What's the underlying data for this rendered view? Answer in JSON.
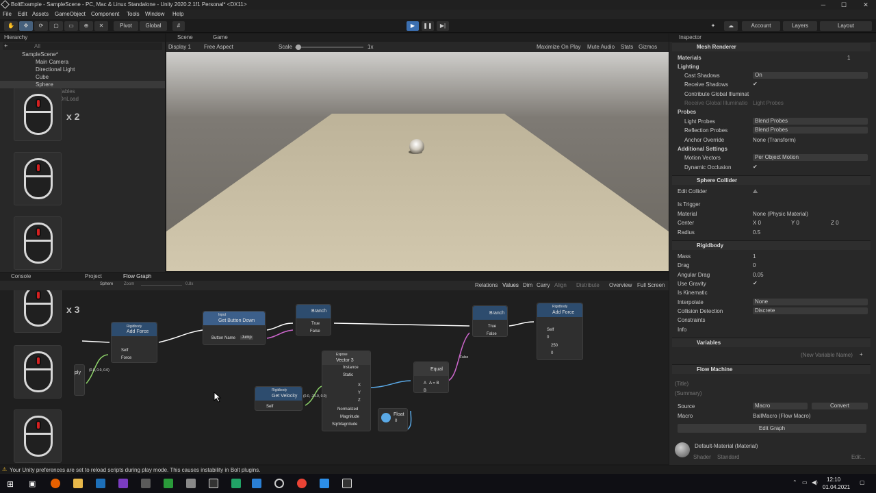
{
  "window": {
    "title": "BoltExample - SampleScene - PC, Mac & Linux Standalone - Unity 2020.2.1f1 Personal* <DX11>",
    "min": "─",
    "max": "☐",
    "close": "✕"
  },
  "menu": [
    "File",
    "Edit",
    "Assets",
    "GameObject",
    "Component",
    "Tools",
    "Window",
    "Help"
  ],
  "toolbar": {
    "pivot": "Pivot",
    "global": "Global",
    "account": "Account",
    "layers": "Layers",
    "layout": "Layout"
  },
  "hierarchy": {
    "tab": "Hierarchy",
    "search_placeholder": "All",
    "scene": "SampleScene*",
    "items": [
      "Main Camera",
      "Directional Light",
      "Cube",
      "Sphere",
      "Scene Variables"
    ],
    "ddol": "DontDestroyOnLoad",
    "mouse_counts": [
      "x 2",
      "x 3"
    ]
  },
  "sceneview": {
    "tabs": [
      "Scene",
      "Game"
    ],
    "display": "Display 1",
    "aspect": "Free Aspect",
    "scale_label": "Scale",
    "scale_value": "1x",
    "options": [
      "Maximize On Play",
      "Mute Audio",
      "Stats",
      "Gizmos"
    ]
  },
  "bottom": {
    "tabs": [
      "Console",
      "Project",
      "Flow Graph"
    ],
    "breadcrumb": "Sphere",
    "zoom_label": "Zoom",
    "zoom_value": "0.8x",
    "options": [
      "Relations",
      "Values",
      "Dim",
      "Carry",
      "Align",
      "Distribute",
      "Overview",
      "Full Screen"
    ],
    "console_msg": "Your Unity preferences are set to reload scripts during play mode. This causes instability in Bolt plugins."
  },
  "graph": {
    "add_force_1": {
      "cat": "Rigidbody",
      "title": "Add Force",
      "ports": [
        "Self",
        "Force"
      ]
    },
    "get_button_down": {
      "cat": "Input",
      "title": "Get Button Down",
      "port": "Button Name",
      "value": "Jump"
    },
    "branch_1": {
      "title": "Branch",
      "true": "True",
      "false": "False"
    },
    "branch_2": {
      "title": "Branch",
      "true": "True",
      "false": "False"
    },
    "add_force_2": {
      "cat": "Rigidbody",
      "title": "Add Force",
      "self": "Self",
      "x": "0",
      "y": "250",
      "z": "0"
    },
    "expose": {
      "cat": "Expose",
      "title": "Vector 3",
      "ports": [
        "Instance",
        "Static"
      ],
      "outs": [
        "X",
        "Y",
        "Z",
        "Normalized",
        "Magnitude",
        "SqrMagnitude"
      ]
    },
    "get_velocity": {
      "cat": "Rigidbody",
      "title": "Get Velocity",
      "self": "Self",
      "vec": "(0.0, -21.0, 0.0)"
    },
    "equal": {
      "title": "Equal",
      "a": "A",
      "ab": "A = B",
      "b": "B"
    },
    "float": {
      "title": "Float",
      "value": "0"
    },
    "vec_left": "(0.0, 0.0, 0.0)",
    "false_label": "False",
    "pd": "ply"
  },
  "inspector": {
    "tab": "Inspector",
    "mesh_renderer": "Mesh Renderer",
    "materials": "Materials",
    "materials_count": "1",
    "lighting": "Lighting",
    "cast_shadows": "Cast Shadows",
    "cast_shadows_val": "On",
    "receive_shadows": "Receive Shadows",
    "contribute_gi": "Contribute Global Illuminat",
    "receive_gi": "Receive Global Illuminatio",
    "receive_gi_val": "Light Probes",
    "probes": "Probes",
    "light_probes": "Light Probes",
    "light_probes_val": "Blend Probes",
    "reflection_probes": "Reflection Probes",
    "reflection_probes_val": "Blend Probes",
    "anchor_override": "Anchor Override",
    "anchor_override_val": "None (Transform)",
    "additional": "Additional Settings",
    "motion_vectors": "Motion Vectors",
    "motion_vectors_val": "Per Object Motion",
    "dynamic_occlusion": "Dynamic Occlusion",
    "sphere_collider": "Sphere Collider",
    "edit_collider": "Edit Collider",
    "is_trigger": "Is Trigger",
    "material": "Material",
    "material_val": "None (Physic Material)",
    "center": "Center",
    "cx": "X 0",
    "cy": "Y 0",
    "cz": "Z 0",
    "radius": "Radius",
    "radius_val": "0.5",
    "rigidbody": "Rigidbody",
    "mass": "Mass",
    "mass_val": "1",
    "drag": "Drag",
    "drag_val": "0",
    "angular_drag": "Angular Drag",
    "angular_drag_val": "0.05",
    "use_gravity": "Use Gravity",
    "is_kinematic": "Is Kinematic",
    "interpolate": "Interpolate",
    "interpolate_val": "None",
    "collision": "Collision Detection",
    "collision_val": "Discrete",
    "constraints": "Constraints",
    "info": "Info",
    "variables": "Variables",
    "new_var": "(New Variable Name)",
    "flow_machine": "Flow Machine",
    "title_ph": "(Title)",
    "summary_ph": "(Summary)",
    "source": "Source",
    "source_val": "Macro",
    "convert": "Convert",
    "macro": "Macro",
    "macro_val": "BallMacro (Flow Macro)",
    "edit_graph": "Edit Graph",
    "default_material": "Default-Material (Material)",
    "shader": "Shader",
    "shader_val": "Standard",
    "edit": "Edit..."
  },
  "taskbar": {
    "time": "12:10",
    "date": "01.04.2021"
  }
}
